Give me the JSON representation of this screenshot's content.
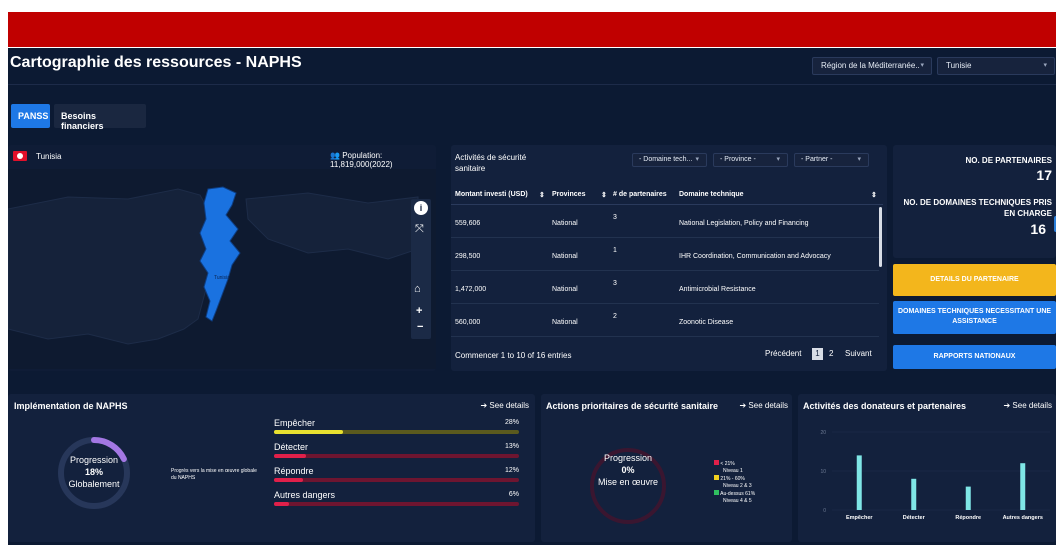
{
  "header": {
    "title": "Cartographie des ressources - NAPHS",
    "region_select": "Région de la Méditerranée..",
    "country_select": "Tunisie"
  },
  "tabs": [
    {
      "label": "PANSS",
      "active": true
    },
    {
      "label": "Besoins financiers",
      "active": false
    }
  ],
  "map_panel": {
    "country": "Tunisia",
    "population": "Population: 11,819,000(2022)",
    "map_label": "Tunisia"
  },
  "activities": {
    "title": "Activités de sécurité sanitaire",
    "filters": [
      "- Domaine tech...",
      "- Province -",
      "- Partner -"
    ],
    "columns": [
      "Montant investi (USD)",
      "Provinces",
      "# de partenaires",
      "Domaine technique"
    ],
    "rows": [
      {
        "amount": "559,606",
        "province": "National",
        "partners": "3",
        "domain": "National Legislation, Policy and Financing"
      },
      {
        "amount": "298,500",
        "province": "National",
        "partners": "1",
        "domain": "IHR Coordination, Communication and Advocacy"
      },
      {
        "amount": "1,472,000",
        "province": "National",
        "partners": "3",
        "domain": "Antimicrobial Resistance"
      },
      {
        "amount": "560,000",
        "province": "National",
        "partners": "2",
        "domain": "Zoonotic Disease"
      }
    ],
    "footer": "Commencer 1 to 10 of 16 entries",
    "pager": {
      "prev": "Précédent",
      "pages": [
        "1",
        "2"
      ],
      "next": "Suivant"
    }
  },
  "stats": {
    "partners_label": "NO. DE PARTENAIRES",
    "partners_value": "17",
    "domains_label": "NO. DE DOMAINES TECHNIQUES PRIS EN CHARGE",
    "domains_value": "16"
  },
  "buttons": {
    "partner_details": "DETAILS DU PARTENAIRE",
    "assist_domains": "DOMAINES TECHNIQUES NECESSITANT UNE ASSISTANCE",
    "reports": "RAPPORTS NATIONAUX"
  },
  "implementation": {
    "title": "Implémentation de NAPHS",
    "see_details": "See details",
    "donut_label_top": "Progression",
    "donut_value": "18%",
    "donut_label_bottom": "Globalement",
    "donut_fraction": 0.18,
    "note": "Progrès vers la mise en œuvre globale du NAPHS",
    "bars": [
      {
        "label": "Empêcher",
        "pct": "28%",
        "fraction": 0.28,
        "color": "#e8e030"
      },
      {
        "label": "Détecter",
        "pct": "13%",
        "fraction": 0.13,
        "color": "#e0204a"
      },
      {
        "label": "Répondre",
        "pct": "12%",
        "fraction": 0.12,
        "color": "#e0204a"
      },
      {
        "label": "Autres dangers",
        "pct": "6%",
        "fraction": 0.06,
        "color": "#e0204a"
      }
    ]
  },
  "priority": {
    "title": "Actions prioritaires de sécurité sanitaire",
    "see_details": "See details",
    "donut_label_top": "Progression",
    "donut_value": "0%",
    "donut_label_bottom": "Mise en œuvre",
    "legend": [
      {
        "range": "< 21%",
        "level": "Niveau 1",
        "color": "#e0204a"
      },
      {
        "range": "21% - 60%",
        "level": "Niveau 2 & 3",
        "color": "#f0d020"
      },
      {
        "range": "Au-dessus 61%",
        "level": "Niveau 4 & 5",
        "color": "#30c060"
      }
    ]
  },
  "donors": {
    "title": "Activités des donateurs et partenaires",
    "see_details": "See details"
  },
  "chart_data": {
    "type": "bar",
    "categories": [
      "Empêcher",
      "Détecter",
      "Répondre",
      "Autres dangers"
    ],
    "values": [
      14,
      8,
      6,
      12
    ],
    "yticks": [
      "20",
      "10",
      "0"
    ],
    "ylim": [
      0,
      20
    ],
    "bar_color": "#7fe6e6",
    "title": "",
    "xlabel": "",
    "ylabel": ""
  }
}
